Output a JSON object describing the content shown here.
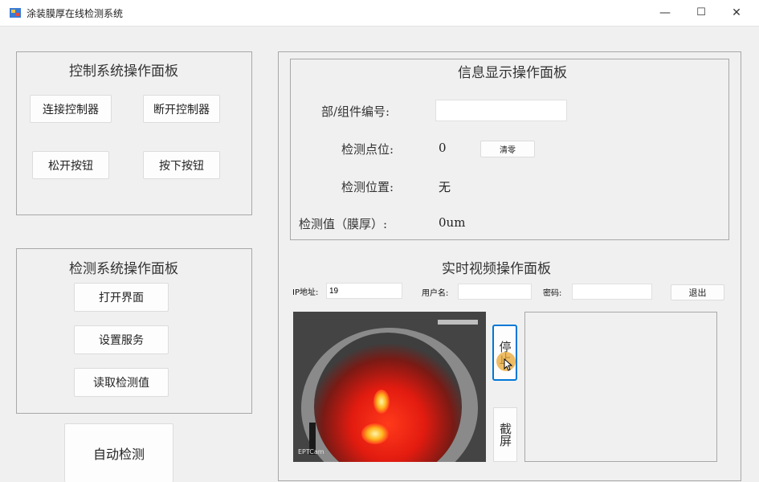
{
  "window": {
    "title": "涂装膜厚在线检测系统",
    "minimize": "—",
    "maximize": "☐",
    "close": "✕"
  },
  "control_panel": {
    "title": "控制系统操作面板",
    "connect_label": "连接控制器",
    "disconnect_label": "断开控制器",
    "release_label": "松开按钮",
    "press_label": "按下按钮"
  },
  "detect_panel": {
    "title": "检测系统操作面板",
    "open_ui_label": "打开界面",
    "set_service_label": "设置服务",
    "read_value_label": "读取检测值"
  },
  "auto_detect_label": "自动检测",
  "info_panel": {
    "title": "信息显示操作面板",
    "part_no_label": "部/组件编号:",
    "part_no_value": "",
    "point_label": "检测点位:",
    "point_value": "0",
    "clear_label": "清零",
    "position_label": "检测位置:",
    "position_value": "无",
    "thickness_label": "检测值（膜厚）:",
    "thickness_value": "0um"
  },
  "video_panel": {
    "title": "实时视频操作面板",
    "ip_label": "IP地址:",
    "ip_value": "19",
    "user_label": "用户名:",
    "user_value": "",
    "password_label": "密码:",
    "password_value": "",
    "exit_label": "退出",
    "stop_label": "停止",
    "screenshot_label": "截屏",
    "overlay_label": "EPTCam"
  },
  "colors": {
    "accent": "#0078d7",
    "cursor_highlight": "#e8a530"
  }
}
